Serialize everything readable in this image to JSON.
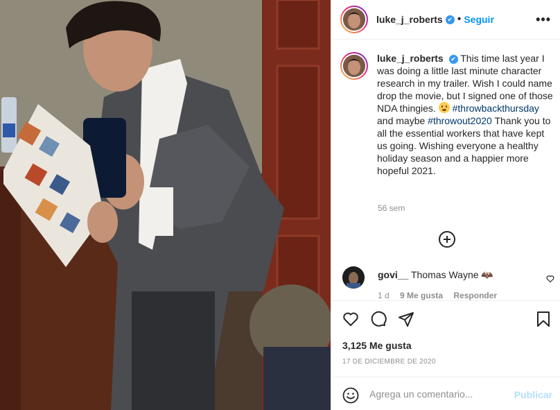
{
  "post": {
    "author": "luke_j_roberts",
    "follow_label": "Seguir",
    "separator": "•",
    "more_label": "•••",
    "verified_mark": "✔",
    "caption": {
      "line1": "This time last year I was doing a little last minute character research in my trailer. Wish I could name drop the movie, but I signed one of those NDA thingies.",
      "hashtag1": "#throwbackthursday",
      "between": " and maybe ",
      "hashtag2": "#throwout2020",
      "line2": " Thank you to all the essential workers that have kept us going. Wishing everyone a healthy holiday season and a happier more hopeful 2021."
    },
    "time_ago": "56 sem",
    "comment": {
      "user": "govi__",
      "text": "Thomas Wayne 🦇",
      "time": "1 d",
      "likes": "9 Me gusta",
      "reply": "Responder"
    },
    "likes_count": "3,125 Me gusta",
    "date": "17 DE DICIEMBRE DE 2020",
    "comment_placeholder": "Agrega un comentario...",
    "publish_label": "Publicar"
  },
  "icons": {
    "like": "heart-icon",
    "comment": "comment-bubble-icon",
    "share": "paper-plane-icon",
    "save": "bookmark-icon",
    "emoji": "smiley-icon",
    "more": "more-dots-icon",
    "load_more": "plus-circle-icon"
  },
  "colors": {
    "link": "#0095f6",
    "hashtag": "#00376b",
    "muted": "#8e8e8e",
    "publish_disabled": "#b2dffc"
  }
}
